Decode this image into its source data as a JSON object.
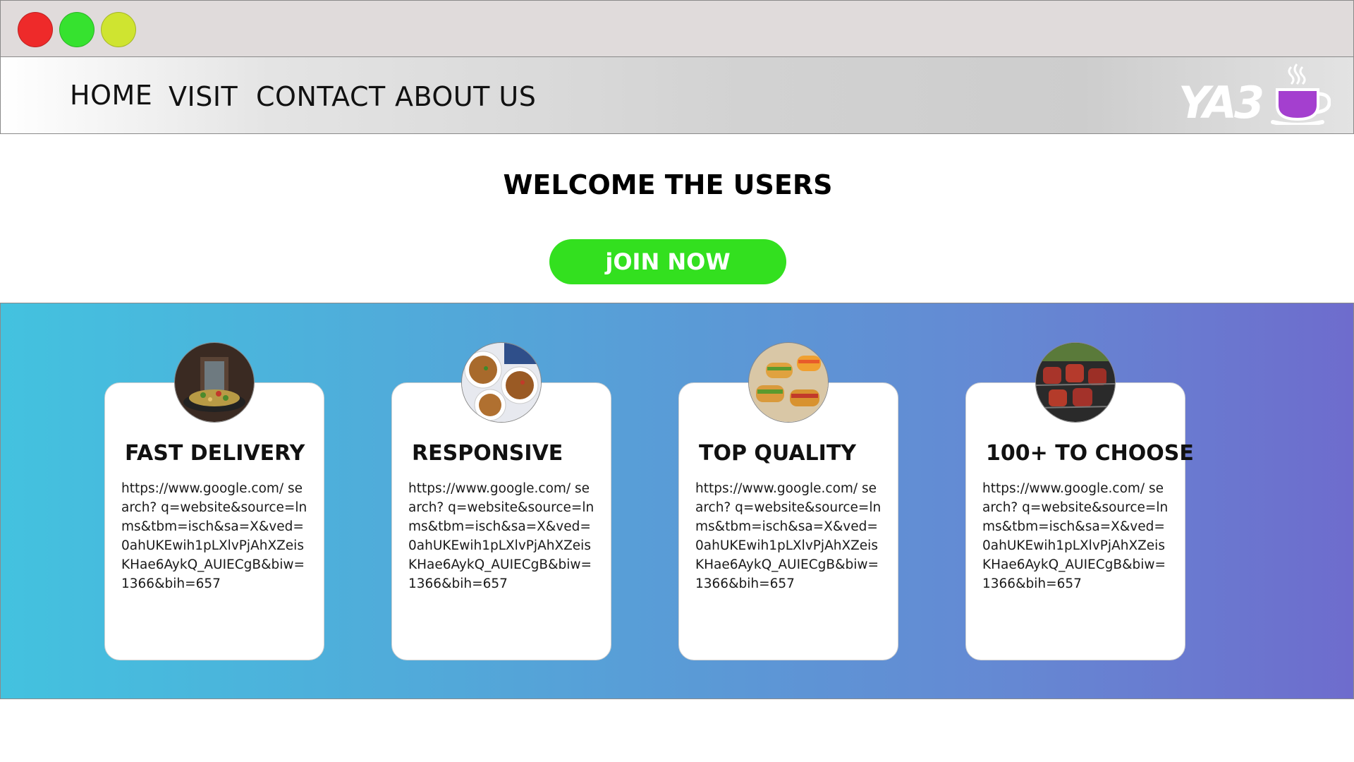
{
  "window": {
    "controls": [
      "close",
      "maximize",
      "minimize"
    ]
  },
  "nav": {
    "items": [
      {
        "label": "HOME"
      },
      {
        "label": "VISIT"
      },
      {
        "label": "CONTACT"
      },
      {
        "label": "ABOUT US"
      }
    ],
    "logo_text": "YA3",
    "logo_icon": "coffee-cup-icon"
  },
  "hero": {
    "title": "WELCOME THE USERS",
    "cta_label": "jOIN NOW"
  },
  "features": [
    {
      "title": "FAST DELIVERY",
      "image": "noodles-wok-image",
      "text": "https://www.google.com/ search? q=website&source=lnms&tbm=isch&sa=X&ved=0ahUKEwih1pLXlvPjAhXZeisKHae6AykQ_AUIECgB&biw=1366&bih=657"
    },
    {
      "title": "RESPONSIVE",
      "image": "noodle-bowls-image",
      "text": "https://www.google.com/ search? q=website&source=lnms&tbm=isch&sa=X&ved=0ahUKEwih1pLXlvPjAhXZeisKHae6AykQ_AUIECgB&biw=1366&bih=657"
    },
    {
      "title": "TOP QUALITY",
      "image": "sandwiches-image",
      "text": "https://www.google.com/ search? q=website&source=lnms&tbm=isch&sa=X&ved=0ahUKEwih1pLXlvPjAhXZeisKHae6AykQ_AUIECgB&biw=1366&bih=657"
    },
    {
      "title": "100+ TO CHOOSE",
      "image": "grilled-skewers-image",
      "text": "https://www.google.com/ search? q=website&source=lnms&tbm=isch&sa=X&ved=0ahUKEwih1pLXlvPjAhXZeisKHae6AykQ_AUIECgB&biw=1366&bih=657"
    }
  ],
  "colors": {
    "close": "#ee2a2a",
    "maximize": "#36e22f",
    "minimize": "#cfe430",
    "cta": "#33e01f",
    "band_start": "#43c2df",
    "band_end": "#6e6ccd",
    "logo_cup": "#a43fcf"
  }
}
